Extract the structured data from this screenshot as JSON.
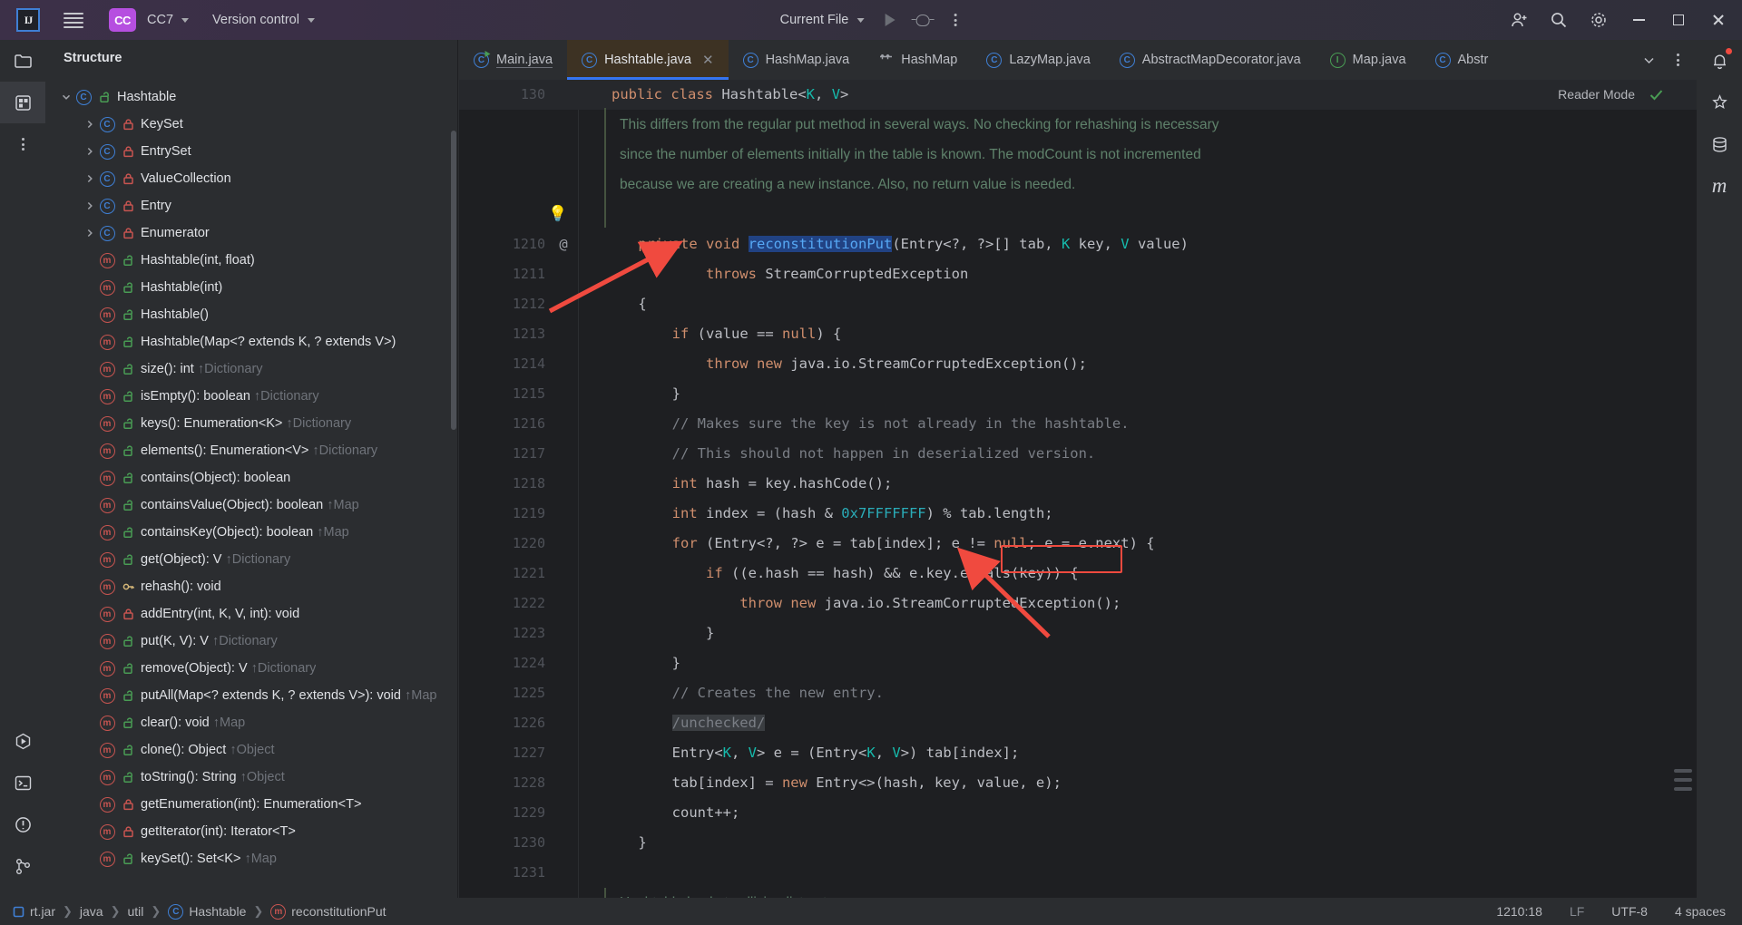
{
  "titlebar": {
    "logo": "IJ",
    "menu_icon": "hamburger-icon",
    "project_badge": "CC",
    "project_name": "CC7",
    "vcs_name": "Version control",
    "current_file": "Current File",
    "run_icon": "run-icon",
    "debug_icon": "debug-icon",
    "more_icon": "more-actions-icon",
    "account_icon": "account-icon",
    "search_icon": "search-icon",
    "settings_icon": "settings-icon",
    "minimize": "minimize-icon",
    "maximize": "maximize-icon",
    "close": "close-icon"
  },
  "left_rail": [
    {
      "name": "project-icon"
    },
    {
      "name": "structure-icon"
    },
    {
      "name": "more-tool-windows-icon"
    },
    {
      "name": "run-tool-icon"
    },
    {
      "name": "terminal-icon"
    },
    {
      "name": "problems-icon"
    },
    {
      "name": "version-control-icon"
    }
  ],
  "right_rail": [
    {
      "name": "notifications-icon"
    },
    {
      "name": "ai-assistant-icon"
    },
    {
      "name": "database-icon"
    },
    {
      "name": "maven-icon"
    }
  ],
  "structure": {
    "title": "Structure",
    "nodes": [
      {
        "depth": 0,
        "arrow": "down",
        "icon": "class-icon",
        "vis": "public",
        "label": "Hashtable",
        "inherit": ""
      },
      {
        "depth": 1,
        "arrow": "right",
        "icon": "class-icon",
        "vis": "private",
        "label": "KeySet",
        "inherit": ""
      },
      {
        "depth": 1,
        "arrow": "right",
        "icon": "class-icon",
        "vis": "private",
        "label": "EntrySet",
        "inherit": ""
      },
      {
        "depth": 1,
        "arrow": "right",
        "icon": "class-icon",
        "vis": "private",
        "label": "ValueCollection",
        "inherit": ""
      },
      {
        "depth": 1,
        "arrow": "right",
        "icon": "class-icon",
        "vis": "private",
        "label": "Entry",
        "inherit": ""
      },
      {
        "depth": 1,
        "arrow": "right",
        "icon": "class-icon",
        "vis": "private",
        "label": "Enumerator",
        "inherit": ""
      },
      {
        "depth": 1,
        "arrow": "none",
        "icon": "method-icon",
        "vis": "public",
        "label": "Hashtable(int, float)",
        "inherit": ""
      },
      {
        "depth": 1,
        "arrow": "none",
        "icon": "method-icon",
        "vis": "public",
        "label": "Hashtable(int)",
        "inherit": ""
      },
      {
        "depth": 1,
        "arrow": "none",
        "icon": "method-icon",
        "vis": "public",
        "label": "Hashtable()",
        "inherit": ""
      },
      {
        "depth": 1,
        "arrow": "none",
        "icon": "method-icon",
        "vis": "public",
        "label": "Hashtable(Map<? extends K, ? extends V>)",
        "inherit": ""
      },
      {
        "depth": 1,
        "arrow": "none",
        "icon": "method-icon",
        "vis": "public",
        "label": "size(): int ",
        "inherit": "↑Dictionary"
      },
      {
        "depth": 1,
        "arrow": "none",
        "icon": "method-icon",
        "vis": "public",
        "label": "isEmpty(): boolean ",
        "inherit": "↑Dictionary"
      },
      {
        "depth": 1,
        "arrow": "none",
        "icon": "method-icon",
        "vis": "public",
        "label": "keys(): Enumeration<K> ",
        "inherit": "↑Dictionary"
      },
      {
        "depth": 1,
        "arrow": "none",
        "icon": "method-icon",
        "vis": "public",
        "label": "elements(): Enumeration<V> ",
        "inherit": "↑Dictionary"
      },
      {
        "depth": 1,
        "arrow": "none",
        "icon": "method-icon",
        "vis": "public",
        "label": "contains(Object): boolean",
        "inherit": ""
      },
      {
        "depth": 1,
        "arrow": "none",
        "icon": "method-icon",
        "vis": "public",
        "label": "containsValue(Object): boolean ",
        "inherit": "↑Map"
      },
      {
        "depth": 1,
        "arrow": "none",
        "icon": "method-icon",
        "vis": "public",
        "label": "containsKey(Object): boolean ",
        "inherit": "↑Map"
      },
      {
        "depth": 1,
        "arrow": "none",
        "icon": "method-icon",
        "vis": "public",
        "label": "get(Object): V ",
        "inherit": "↑Dictionary"
      },
      {
        "depth": 1,
        "arrow": "none",
        "icon": "method-icon",
        "vis": "protected",
        "label": "rehash(): void",
        "inherit": ""
      },
      {
        "depth": 1,
        "arrow": "none",
        "icon": "method-icon",
        "vis": "private",
        "label": "addEntry(int, K, V, int): void",
        "inherit": ""
      },
      {
        "depth": 1,
        "arrow": "none",
        "icon": "method-icon",
        "vis": "public",
        "label": "put(K, V): V ",
        "inherit": "↑Dictionary"
      },
      {
        "depth": 1,
        "arrow": "none",
        "icon": "method-icon",
        "vis": "public",
        "label": "remove(Object): V ",
        "inherit": "↑Dictionary"
      },
      {
        "depth": 1,
        "arrow": "none",
        "icon": "method-icon",
        "vis": "public",
        "label": "putAll(Map<? extends K, ? extends V>): void ",
        "inherit": "↑Map"
      },
      {
        "depth": 1,
        "arrow": "none",
        "icon": "method-icon",
        "vis": "public",
        "label": "clear(): void ",
        "inherit": "↑Map"
      },
      {
        "depth": 1,
        "arrow": "none",
        "icon": "method-icon",
        "vis": "public",
        "label": "clone(): Object ",
        "inherit": "↑Object"
      },
      {
        "depth": 1,
        "arrow": "none",
        "icon": "method-icon",
        "vis": "public",
        "label": "toString(): String ",
        "inherit": "↑Object"
      },
      {
        "depth": 1,
        "arrow": "none",
        "icon": "method-icon",
        "vis": "private",
        "label": "getEnumeration(int): Enumeration<T>",
        "inherit": ""
      },
      {
        "depth": 1,
        "arrow": "none",
        "icon": "method-icon",
        "vis": "private",
        "label": "getIterator(int): Iterator<T>",
        "inherit": ""
      },
      {
        "depth": 1,
        "arrow": "none",
        "icon": "method-icon",
        "vis": "public",
        "label": "keySet(): Set<K> ",
        "inherit": "↑Map"
      }
    ]
  },
  "tabs": [
    {
      "label": "Main.java",
      "icon": "java-run-class-icon",
      "active": false,
      "closable": false
    },
    {
      "label": "Hashtable.java",
      "icon": "java-class-icon",
      "active": true,
      "closable": true
    },
    {
      "label": "HashMap.java",
      "icon": "java-class-icon",
      "active": false,
      "closable": false
    },
    {
      "label": "HashMap",
      "icon": "diff-icon",
      "active": false,
      "closable": false
    },
    {
      "label": "LazyMap.java",
      "icon": "java-class-icon",
      "active": false,
      "closable": false
    },
    {
      "label": "AbstractMapDecorator.java",
      "icon": "java-class-icon",
      "active": false,
      "closable": false
    },
    {
      "label": "Map.java",
      "icon": "java-interface-icon",
      "active": false,
      "closable": false
    },
    {
      "label": "Abstr",
      "icon": "java-class-icon",
      "active": false,
      "closable": false
    }
  ],
  "tabs_overflow": {
    "chevron": "chevron-down-icon",
    "kebab": "more-tabs-icon"
  },
  "editor": {
    "reader_mode_label": "Reader Mode",
    "reader_mode_check": "checkmark-icon",
    "bulb_icon": "intention-bulb-icon",
    "annotation_gutter": "@",
    "doc_lines": [
      "This differs from the regular put method in several ways. No checking for rehashing is necessary",
      "since the number of elements initially in the table is known. The modCount is not incremented",
      "because we are creating a new instance. Also, no return value is needed."
    ],
    "header_line": {
      "num": "130",
      "text": "public class Hashtable<K, V>"
    },
    "lines": [
      {
        "num": "1210",
        "text": "    private void reconstitutionPut(Entry<?, ?>[] tab, K key, V value)"
      },
      {
        "num": "1211",
        "text": "            throws StreamCorruptedException"
      },
      {
        "num": "1212",
        "text": "    {"
      },
      {
        "num": "1213",
        "text": "        if (value == null) {"
      },
      {
        "num": "1214",
        "text": "            throw new java.io.StreamCorruptedException();"
      },
      {
        "num": "1215",
        "text": "        }"
      },
      {
        "num": "1216",
        "text": "        // Makes sure the key is not already in the hashtable."
      },
      {
        "num": "1217",
        "text": "        // This should not happen in deserialized version."
      },
      {
        "num": "1218",
        "text": "        int hash = key.hashCode();"
      },
      {
        "num": "1219",
        "text": "        int index = (hash & 0x7FFFFFFF) % tab.length;"
      },
      {
        "num": "1220",
        "text": "        for (Entry<?, ?> e = tab[index]; e != null; e = e.next) {"
      },
      {
        "num": "1221",
        "text": "            if ((e.hash == hash) && e.key.equals(key)) {"
      },
      {
        "num": "1222",
        "text": "                throw new java.io.StreamCorruptedException();"
      },
      {
        "num": "1223",
        "text": "            }"
      },
      {
        "num": "1224",
        "text": "        }"
      },
      {
        "num": "1225",
        "text": "        // Creates the new entry."
      },
      {
        "num": "1226",
        "text": "        /unchecked/"
      },
      {
        "num": "1227",
        "text": "        Entry<K, V> e = (Entry<K, V>) tab[index];"
      },
      {
        "num": "1228",
        "text": "        tab[index] = new Entry<>(hash, key, value, e);"
      },
      {
        "num": "1229",
        "text": "        count++;"
      },
      {
        "num": "1230",
        "text": "    }"
      },
      {
        "num": "1231",
        "text": ""
      }
    ],
    "footer_comment": "Hashtable bucket collision list entry"
  },
  "annotations": {
    "highlight_box_label": "equals(key))",
    "arrow_1": "pointer-arrow-to-method-name",
    "arrow_2": "pointer-arrow-to-equals-call"
  },
  "status": {
    "breadcrumbs": [
      {
        "label": "rt.jar",
        "icon": "jar-icon"
      },
      {
        "label": "java",
        "icon": ""
      },
      {
        "label": "util",
        "icon": ""
      },
      {
        "label": "Hashtable",
        "icon": "class-icon"
      },
      {
        "label": "reconstitutionPut",
        "icon": "method-icon"
      }
    ],
    "position": "1210:18",
    "line_sep": "LF",
    "encoding": "UTF-8",
    "indent": "4 spaces"
  },
  "colors": {
    "accent": "#3574f0",
    "active_tab_bg": "#3d3223",
    "highlight_red": "#f04a3f",
    "badge_purple": "#b64fe0",
    "keyword": "#cf8e6d",
    "method": "#56a8f5",
    "number": "#2aacb8",
    "comment": "#7a7e85",
    "generic": "#16baac",
    "doc": "#5f826b"
  }
}
